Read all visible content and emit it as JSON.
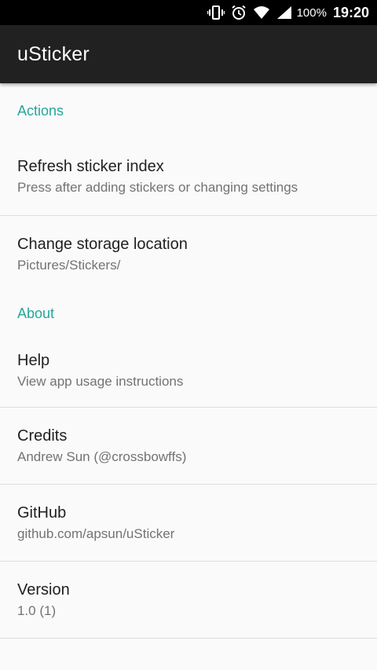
{
  "status_bar": {
    "battery_percent": "100%",
    "time": "19:20",
    "icons": [
      "vibrate-icon",
      "alarm-icon",
      "wifi-icon",
      "cell-signal-icon"
    ]
  },
  "app_bar": {
    "title": "uSticker",
    "background_color": "#212121"
  },
  "accent_color": "#26a69a",
  "sections": {
    "actions": {
      "header": "Actions",
      "items": [
        {
          "title": "Refresh sticker index",
          "summary": "Press after adding stickers or changing settings"
        },
        {
          "title": "Change storage location",
          "summary": "Pictures/Stickers/"
        }
      ]
    },
    "about": {
      "header": "About",
      "items": [
        {
          "title": "Help",
          "summary": "View app usage instructions"
        },
        {
          "title": "Credits",
          "summary": "Andrew Sun (@crossbowffs)"
        },
        {
          "title": "GitHub",
          "summary": "github.com/apsun/uSticker"
        },
        {
          "title": "Version",
          "summary": "1.0 (1)"
        }
      ]
    }
  }
}
